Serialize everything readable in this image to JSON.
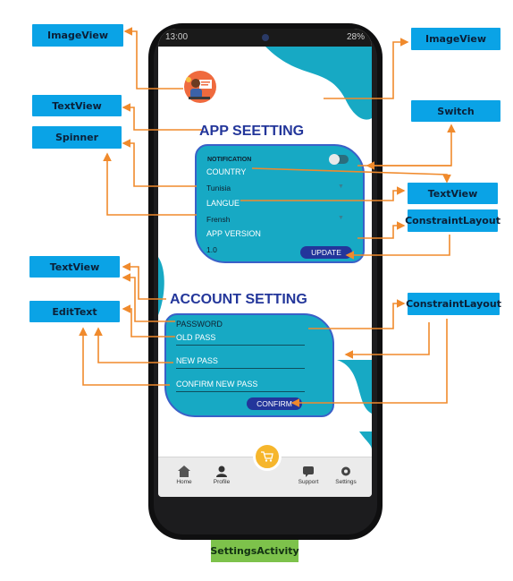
{
  "callouts": {
    "imageview_left": "ImageView",
    "imageview_right": "ImageView",
    "textview_1": "TextView",
    "switch": "Switch",
    "spinner": "Spinner",
    "textview_right": "TextView",
    "constraintlayout_1": "ConstraintLayout",
    "textview_2": "TextView",
    "edittext": "EditText",
    "constraintlayout_2": "ConstraintLayout"
  },
  "activity_label": "SettingsActivity",
  "status_bar": {
    "left": "13:00",
    "right": "28%"
  },
  "app_setting": {
    "title": "APP SEETTING",
    "notification": "NOTIFICATION",
    "country_label": "COUNTRY",
    "country_value": "Tunisia",
    "langue_label": "LANGUE",
    "langue_value": "Frensh",
    "version_label": "APP VERSION",
    "version_value": "1.0",
    "update_button": "UPDATE"
  },
  "account_setting": {
    "title": "ACCOUNT SETTING",
    "password_label": "PASSWORD",
    "old_pass": "OLD PASS",
    "new_pass": "NEW PASS",
    "confirm_pass": "CONFIRM NEW PASS",
    "confirm_button": "CONFIRM"
  },
  "nav": {
    "home": "Home",
    "profile": "Profile",
    "support": "Support",
    "settings": "Settings"
  },
  "colors": {
    "callout_blue": "#0aa3e6",
    "arrow_orange": "#f08a2c",
    "card_teal": "#17a9c4",
    "title_navy": "#23369a",
    "activity_green": "#7dc24b"
  },
  "icons": [
    "avatar-icon",
    "home-icon",
    "profile-icon",
    "cart-icon",
    "support-icon",
    "settings-icon",
    "dropdown-caret-icon"
  ]
}
